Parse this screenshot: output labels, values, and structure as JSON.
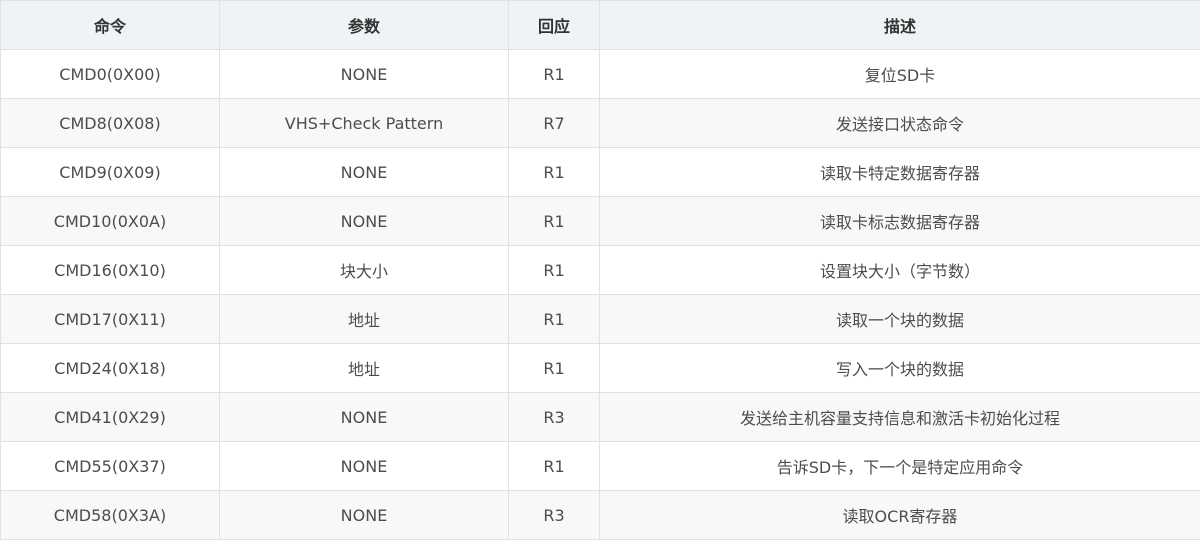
{
  "table": {
    "headers": [
      "命令",
      "参数",
      "回应",
      "描述"
    ],
    "rows": [
      [
        "CMD0(0X00)",
        "NONE",
        "R1",
        "复位SD卡"
      ],
      [
        "CMD8(0X08)",
        "VHS+Check Pattern",
        "R7",
        "发送接口状态命令"
      ],
      [
        "CMD9(0X09)",
        "NONE",
        "R1",
        "读取卡特定数据寄存器"
      ],
      [
        "CMD10(0X0A)",
        "NONE",
        "R1",
        "读取卡标志数据寄存器"
      ],
      [
        "CMD16(0X10)",
        "块大小",
        "R1",
        "设置块大小（字节数）"
      ],
      [
        "CMD17(0X11)",
        "地址",
        "R1",
        "读取一个块的数据"
      ],
      [
        "CMD24(0X18)",
        "地址",
        "R1",
        "写入一个块的数据"
      ],
      [
        "CMD41(0X29)",
        "NONE",
        "R3",
        "发送给主机容量支持信息和激活卡初始化过程"
      ],
      [
        "CMD55(0X37)",
        "NONE",
        "R1",
        "告诉SD卡，下一个是特定应用命令"
      ],
      [
        "CMD58(0X3A)",
        "NONE",
        "R3",
        "读取OCR寄存器"
      ]
    ]
  }
}
